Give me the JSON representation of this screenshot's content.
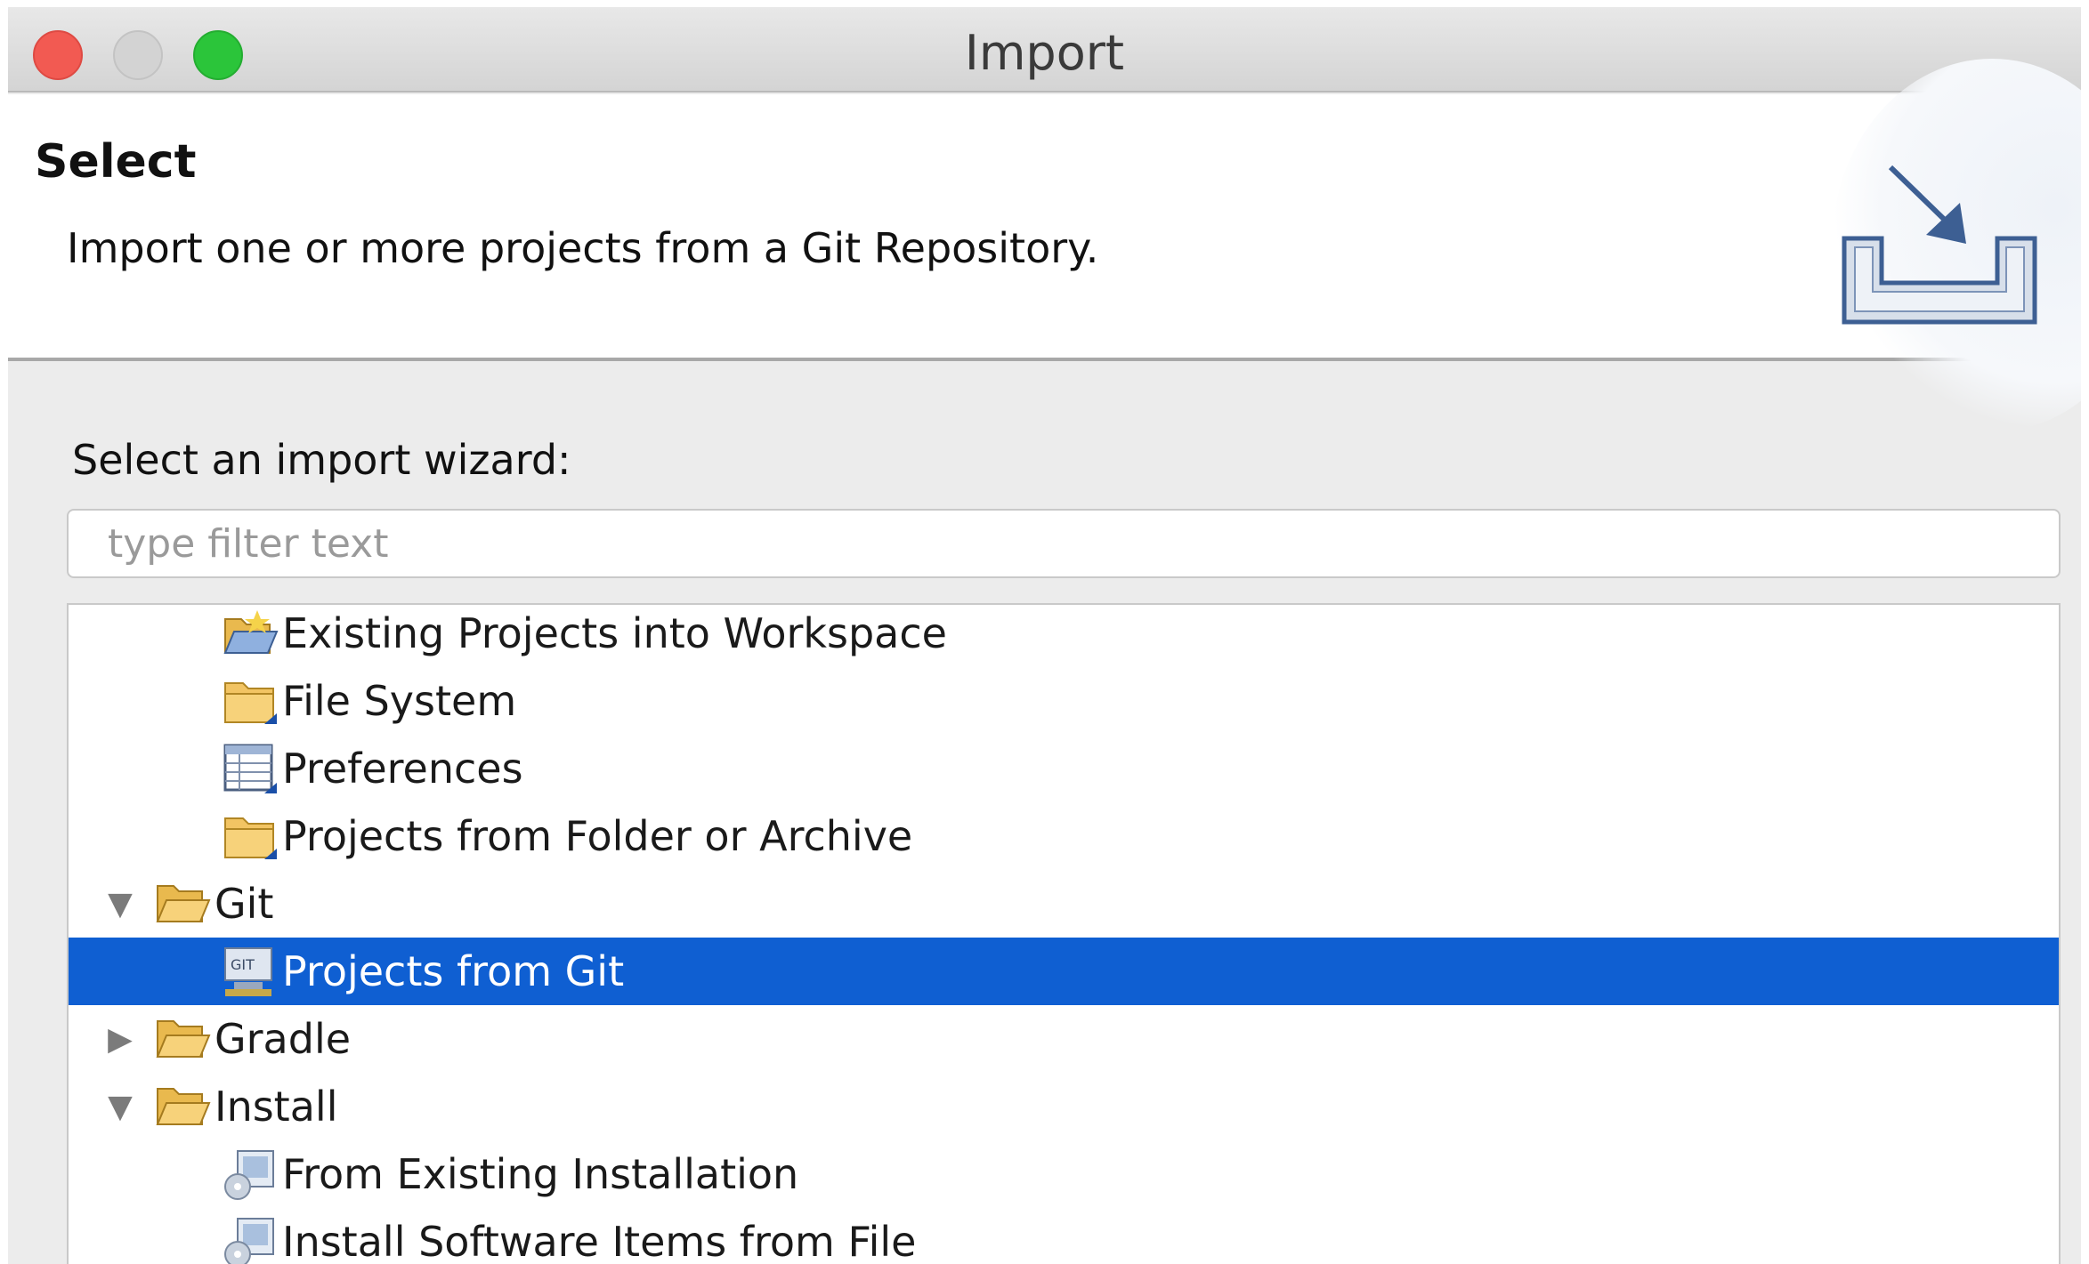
{
  "window": {
    "title": "Import"
  },
  "banner": {
    "title": "Select",
    "description": "Import one or more projects from a Git Repository."
  },
  "wizard": {
    "label": "Select an import wizard:",
    "filter_placeholder": "type filter text",
    "filter_value": ""
  },
  "tree": {
    "items": [
      {
        "label": "Existing Projects into Workspace",
        "icon": "open-project-folder-icon",
        "level": 2,
        "selected": false
      },
      {
        "label": "File System",
        "icon": "folder-icon",
        "level": 2,
        "selected": false
      },
      {
        "label": "Preferences",
        "icon": "preferences-table-icon",
        "level": 2,
        "selected": false
      },
      {
        "label": "Projects from Folder or Archive",
        "icon": "folder-icon",
        "level": 2,
        "selected": false
      },
      {
        "label": "Git",
        "icon": "open-folder-icon",
        "level": 1,
        "expanded": true,
        "selected": false
      },
      {
        "label": "Projects from Git",
        "icon": "git-repository-icon",
        "level": 2,
        "selected": true
      },
      {
        "label": "Gradle",
        "icon": "open-folder-icon",
        "level": 1,
        "expanded": false,
        "selected": false
      },
      {
        "label": "Install",
        "icon": "open-folder-icon",
        "level": 1,
        "expanded": true,
        "selected": false
      },
      {
        "label": "From Existing Installation",
        "icon": "install-icon",
        "level": 2,
        "selected": false
      },
      {
        "label": "Install Software Items from File",
        "icon": "install-icon",
        "level": 2,
        "selected": false
      }
    ]
  },
  "colors": {
    "selection": "#0f5fd2",
    "folder": "#f2c463"
  }
}
